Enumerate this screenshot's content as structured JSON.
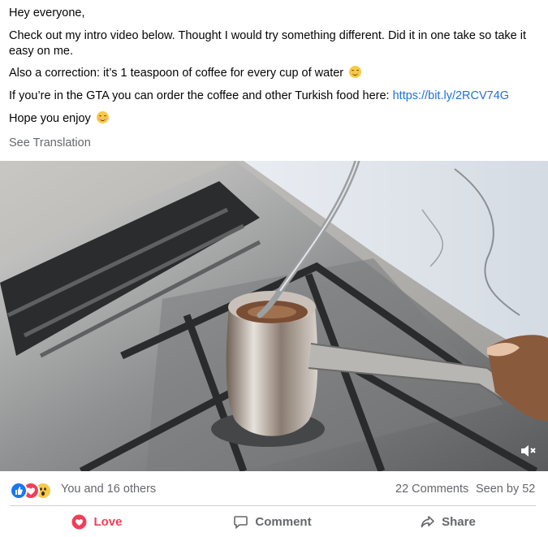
{
  "post": {
    "greeting": "Hey everyone,",
    "paragraph1": "Check out my intro video below. Thought I would try something different. Did it in one take so take it easy on me.",
    "paragraph2": "Also a correction: it’s 1 teaspoon of coffee for every cup of water",
    "paragraph3_prefix": "If you’re in the GTA you can order the coffee and other Turkish food here: ",
    "paragraph3_link": "https://bit.ly/2RCV74G",
    "paragraph4": "Hope you enjoy",
    "see_translation": "See Translation"
  },
  "video": {
    "muted": true,
    "mute_icon": "speaker-muted-icon"
  },
  "stats": {
    "reaction_icons": [
      "like-icon",
      "love-icon",
      "wow-icon"
    ],
    "reactions_text": "You and 16 others",
    "comments": "22 Comments",
    "seen_by": "Seen by 52"
  },
  "actions": {
    "love": "Love",
    "comment": "Comment",
    "share": "Share"
  },
  "colors": {
    "link": "#216fdb",
    "love": "#f33e58",
    "muted_text": "#65676b",
    "like": "#1877f2",
    "wow": "#f7c948"
  }
}
